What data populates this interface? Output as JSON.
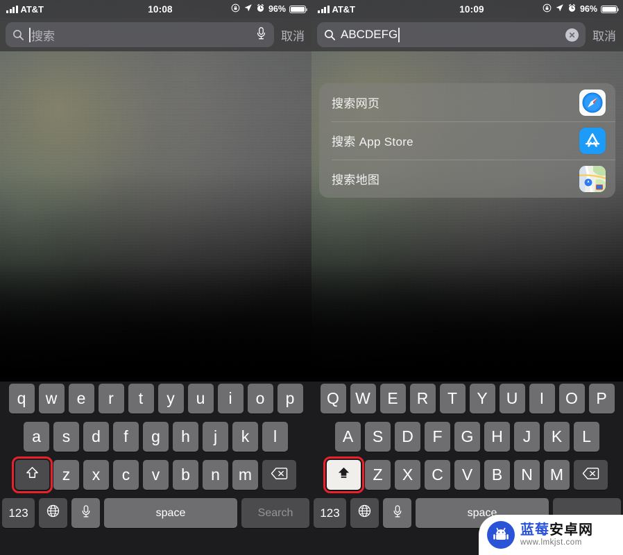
{
  "panes": [
    {
      "id": "left",
      "status_bar": {
        "carrier": "AT&T",
        "time": "10:08",
        "battery_percent": "96%",
        "icons": [
          "signal-bars-icon",
          "rotation-lock-icon",
          "location-arrow-icon",
          "alarm-clock-icon",
          "battery-icon"
        ]
      },
      "search": {
        "value": "",
        "placeholder": "搜索",
        "cancel_label": "取消",
        "magnifier_icon": "search-icon",
        "trailing_icon": "microphone-icon",
        "has_caret": true
      },
      "suggestions": [],
      "keyboard": {
        "row1": [
          "q",
          "w",
          "e",
          "r",
          "t",
          "y",
          "u",
          "i",
          "o",
          "p"
        ],
        "row2": [
          "a",
          "s",
          "d",
          "f",
          "g",
          "h",
          "j",
          "k",
          "l"
        ],
        "row3": [
          "z",
          "x",
          "c",
          "v",
          "b",
          "n",
          "m"
        ],
        "shift_icon": "shift-arrow-outline-icon",
        "shift_active": false,
        "shift_highlighted": true,
        "backspace_icon": "backspace-icon",
        "numeric_label": "123",
        "globe_icon": "globe-icon",
        "mic_icon": "microphone-icon",
        "space_label": "space",
        "return_label": "Search"
      }
    },
    {
      "id": "right",
      "status_bar": {
        "carrier": "AT&T",
        "time": "10:09",
        "battery_percent": "96%",
        "icons": [
          "signal-bars-icon",
          "rotation-lock-icon",
          "location-arrow-icon",
          "alarm-clock-icon",
          "battery-icon"
        ]
      },
      "search": {
        "value": "ABCDEFG",
        "placeholder": "搜索",
        "cancel_label": "取消",
        "magnifier_icon": "search-icon",
        "trailing_icon": "clear-text-icon",
        "has_caret": true
      },
      "suggestions": [
        {
          "label": "搜索网页",
          "icon": "safari-icon"
        },
        {
          "label": "搜索 App Store",
          "icon": "app-store-icon"
        },
        {
          "label": "搜索地图",
          "icon": "maps-icon"
        }
      ],
      "keyboard": {
        "row1": [
          "Q",
          "W",
          "E",
          "R",
          "T",
          "Y",
          "U",
          "I",
          "O",
          "P"
        ],
        "row2": [
          "A",
          "S",
          "D",
          "F",
          "G",
          "H",
          "J",
          "K",
          "L"
        ],
        "row3": [
          "Z",
          "X",
          "C",
          "V",
          "B",
          "N",
          "M"
        ],
        "shift_icon": "shift-arrow-filled-icon",
        "shift_active": true,
        "shift_highlighted": true,
        "backspace_icon": "backspace-icon",
        "numeric_label": "123",
        "globe_icon": "globe-icon",
        "mic_icon": "microphone-icon",
        "space_label": "space",
        "return_label": ""
      }
    }
  ],
  "watermark": {
    "title_blue": "蓝莓",
    "title_black": "安卓网",
    "url": "www.lmkjst.com",
    "logo_icon": "android-robot-icon"
  },
  "colors": {
    "keyboard_bg": "#1c1c1e",
    "key_bg": "#6e6e70",
    "key_dark_bg": "#4b4b4d",
    "shift_active_bg": "#f0efec",
    "highlight_red": "#e8222a",
    "watermark_blue": "#2b53d8"
  }
}
